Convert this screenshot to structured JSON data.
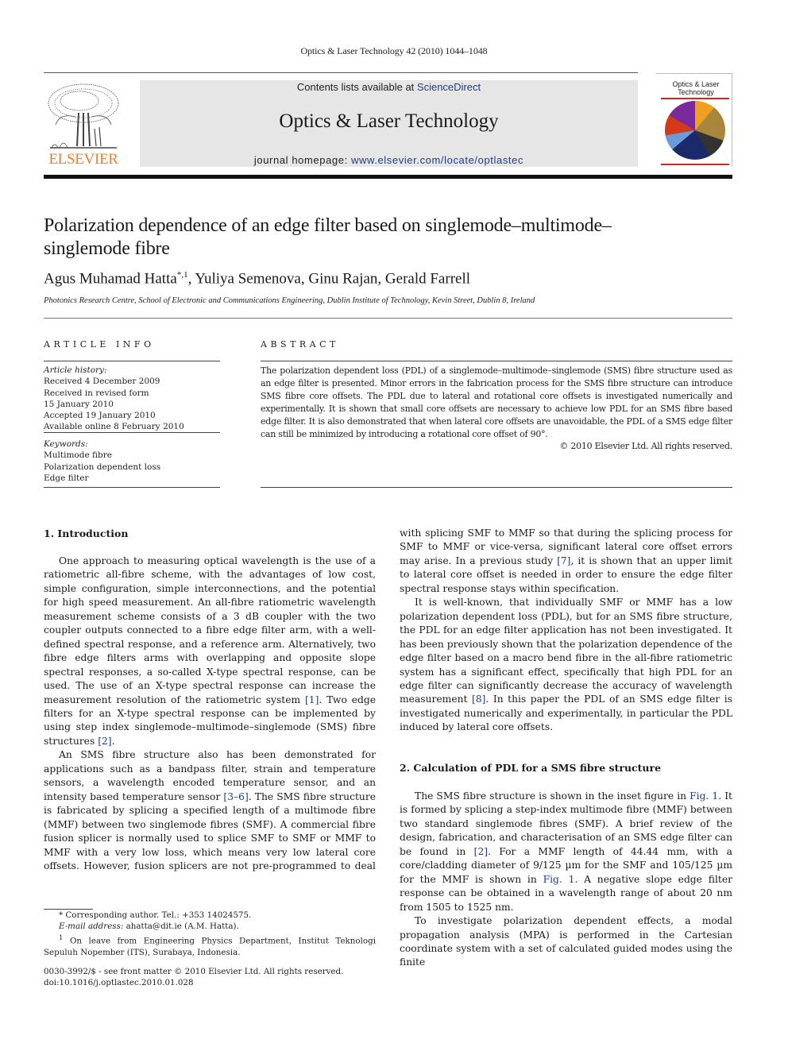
{
  "header": {
    "running_head": "Optics & Laser Technology 42 (2010) 1044–1048",
    "publisher_logo_text": "ELSEVIER",
    "contents_prefix": "Contents lists available at ",
    "contents_link": "ScienceDirect",
    "journal_name": "Optics & Laser Technology",
    "homepage_prefix": "journal homepage: ",
    "homepage_link": "www.elsevier.com/locate/optlastec",
    "cover_title_line1": "Optics & Laser",
    "cover_title_line2": "Technology",
    "colors": {
      "link": "#1c3d8f",
      "elsevier_orange": "#f07e26",
      "masthead_bg": "#e6e6e6"
    }
  },
  "article": {
    "title_line1": "Polarization dependence of an edge filter based on singlemode–multimode–",
    "title_line2": "singlemode fibre",
    "authors": "Agus Muhamad Hatta",
    "author_marks": "*,1",
    "authors_rest": ", Yuliya Semenova, Ginu Rajan, Gerald Farrell",
    "affiliation": "Photonics Research Centre, School of Electronic and Communications Engineering, Dublin Institute of Technology, Kevin Street, Dublin 8, Ireland"
  },
  "article_info": {
    "label": "ARTICLE INFO",
    "history_label": "Article history:",
    "history": [
      "Received 4 December 2009",
      "Received in revised form",
      "15 January 2010",
      "Accepted 19 January 2010",
      "Available online 8 February 2010"
    ],
    "keywords_label": "Keywords:",
    "keywords": [
      "Multimode fibre",
      "Polarization dependent loss",
      "Edge filter"
    ]
  },
  "abstract": {
    "label": "ABSTRACT",
    "text": "The polarization dependent loss (PDL) of a singlemode–multimode–singlemode (SMS) fibre structure used as an edge filter is presented. Minor errors in the fabrication process for the SMS fibre structure can introduce SMS fibre core offsets. The PDL due to lateral and rotational core offsets is investigated numerically and experimentally. It is shown that small core offsets are necessary to achieve low PDL for an SMS fibre based edge filter. It is also demonstrated that when lateral core offsets are unavoidable, the PDL of a SMS edge filter can still be minimized by introducing a rotational core offset of 90°.",
    "copyright": "© 2010 Elsevier Ltd. All rights reserved."
  },
  "body": {
    "section1_heading": "1.  Introduction",
    "s1_p1_a": "One approach to measuring optical wavelength is the use of a ratiometric all-fibre scheme, with the advantages of low cost, simple configuration, simple interconnections, and the potential for high speed measurement. An all-fibre ratiometric wavelength measurement scheme consists of a 3 dB coupler with the two coupler outputs connected to a fibre edge filter arm, with a well-defined spectral response, and a reference arm. Alternatively, two fibre edge filters arms with overlapping and opposite slope spectral responses, a so-called X-type spectral response, can be used. The use of an X-type spectral response can increase the measurement resolution of the ratiometric system ",
    "ref1": "[1]",
    "s1_p1_b": ". Two edge filters for an X-type spectral response can be implemented by using step index singlemode–multimode–singlemode (SMS) fibre structures ",
    "ref2": "[2]",
    "s1_p1_c": ".",
    "s1_p2_a": "An SMS fibre structure also has been demonstrated for applications such as a bandpass filter, strain and temperature sensors, a wavelength encoded temperature sensor, and an intensity based temperature sensor ",
    "ref3_6": "[3–6]",
    "s1_p2_b": ". The SMS fibre structure is fabricated by splicing a specified length of a multimode fibre (MMF) between two singlemode fibres (SMF). A commercial fibre fusion splicer is normally used to splice SMF to SMF or MMF to MMF with a very low loss, which means very low lateral core offsets. However, fusion splicers are not pre-programmed to deal with splicing SMF to MMF so that during the splicing process for SMF to MMF or vice-versa, significant lateral core offset errors may arise. In a previous study ",
    "ref7": "[7]",
    "s1_p2_c": ", it is shown that an upper limit to lateral core offset is needed in order to ensure the edge filter spectral response stays within specification.",
    "s1_p3_a": "It is well-known, that individually SMF or MMF has a low polarization dependent loss (PDL), but for an SMS fibre structure, the PDL for an edge filter application has not been investigated. It has been previously shown that the polarization dependence of the edge filter based on a macro bend fibre in the all-fibre ratiometric system has a significant effect, specifically that high PDL for an edge filter can significantly decrease the accuracy of wavelength measurement ",
    "ref8": "[8]",
    "s1_p3_b": ". In this paper the PDL of an SMS edge filter is investigated numerically and experimentally, in particular the PDL induced by lateral core offsets.",
    "section2_heading": "2.  Calculation of PDL for a SMS fibre structure",
    "s2_p1_a": "The SMS fibre structure is shown in the inset figure in ",
    "fig1": "Fig. 1",
    "s2_p1_b": ". It is formed by splicing a step-index multimode fibre (MMF) between two standard singlemode fibres (SMF). A brief review of the design, fabrication, and characterisation of an SMS edge filter can be found in ",
    "s2_p1_c": ". For a MMF length of 44.44 mm, with a core/cladding diameter of 9/125 µm for the SMF and 105/125 µm for the MMF is shown in ",
    "s2_p1_d": ". A negative slope edge filter response can be obtained in a wavelength range of about 20 nm from 1505 to 1525 nm.",
    "s2_p2": "To investigate polarization dependent effects, a modal propagation analysis (MPA) is performed in the Cartesian coordinate system with a set of calculated guided modes using the finite"
  },
  "footnotes": {
    "corresponding": "* Corresponding author. Tel.: +353 14024575.",
    "email_label": "E-mail address:",
    "email": " ahatta@dit.ie (A.M. Hatta).",
    "note1_mark": "1",
    "note1": " On leave from Engineering Physics Department, Institut Teknologi Sepuluh Nopember (ITS), Surabaya, Indonesia.",
    "issn": "0030-3992/$ - see front matter © 2010 Elsevier Ltd. All rights reserved.",
    "doi": "doi:10.1016/j.optlastec.2010.01.028"
  }
}
